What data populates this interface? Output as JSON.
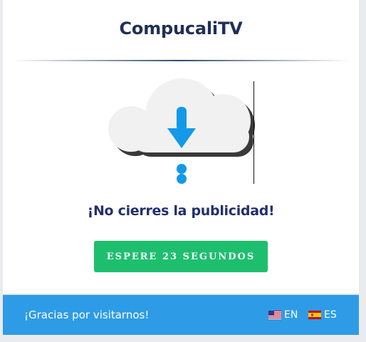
{
  "site": {
    "title": "CompucaliTV"
  },
  "main": {
    "headline": "¡No cierres la publicidad!",
    "wait_button_label": "ESPERE 23 SEGUNDOS",
    "graphic_icon": "cloud-download-icon"
  },
  "footer": {
    "thanks_text": "¡Gracias por visitarnos!",
    "languages": [
      {
        "code": "EN",
        "flag": "us-flag-icon"
      },
      {
        "code": "ES",
        "flag": "es-flag-icon"
      }
    ]
  },
  "colors": {
    "title": "#1f2f57",
    "headline": "#23306b",
    "button": "#1dbf6e",
    "footer": "#2e9be6",
    "arrow": "#1499e8"
  }
}
